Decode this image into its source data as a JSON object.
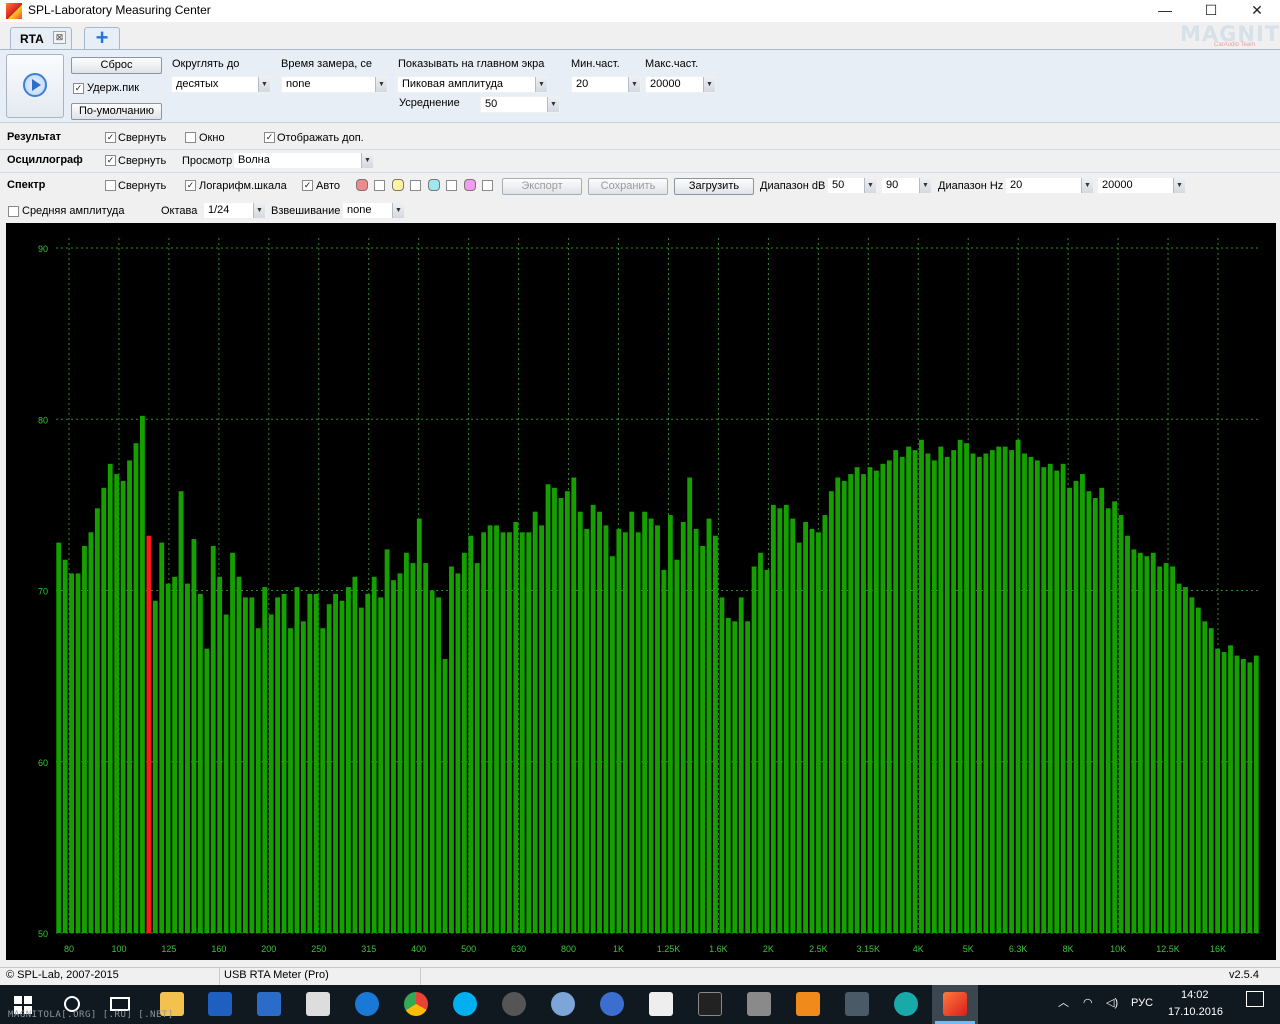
{
  "window": {
    "title": "SPL-Laboratory Measuring Center",
    "min": "—",
    "max": "☐",
    "close": "✕"
  },
  "tabs": {
    "rta_label": "RTA",
    "close_glyph": "⊠",
    "add_glyph": "+"
  },
  "logo": {
    "main": "MAGNITOLA",
    "sub": "CarAudio Team"
  },
  "toolbar": {
    "reset": "Сброс",
    "hold_peak": "Удерж.пик",
    "hold_peak_checked": true,
    "default": "По-умолчанию",
    "round_label": "Округлять до",
    "round_value": "десятых",
    "time_label": "Время замера, се",
    "time_value": "none",
    "show_label": "Показывать на главном экра",
    "show_value": "Пиковая амплитуда",
    "avg_label": "Усреднение",
    "avg_value": "50",
    "min_freq_label": "Мин.част.",
    "min_freq_value": "20",
    "max_freq_label": "Макс.част.",
    "max_freq_value": "20000"
  },
  "result_row": {
    "label": "Результат",
    "collapse": "Свернуть",
    "window": "Окно",
    "show_extra": "Отображать доп."
  },
  "osc_row": {
    "label": "Осциллограф",
    "collapse": "Свернуть",
    "view_label": "Просмотр",
    "view_value": "Волна"
  },
  "spectrum_row": {
    "label": "Спектр",
    "collapse": "Свернуть",
    "log_scale": "Логарифм.шкала",
    "auto": "Авто",
    "colors": [
      "#f08a8a",
      "#fff3a0",
      "#9ee8f0",
      "#f49af0"
    ],
    "export": "Экспорт",
    "save": "Сохранить",
    "load": "Загрузить",
    "db_range_label": "Диапазон dB",
    "db_min": "50",
    "db_max": "90",
    "hz_range_label": "Диапазон Hz",
    "hz_min": "20",
    "hz_max": "20000"
  },
  "fourth_row": {
    "avg_amp": "Средняя амплитуда",
    "octave_label": "Октава",
    "octave_value": "1/24",
    "weighting_label": "Взвешивание",
    "weighting_value": "none"
  },
  "chart_data": {
    "type": "bar",
    "ylim": [
      50,
      90
    ],
    "y_ticks": [
      "90",
      "80",
      "70",
      "60",
      "50"
    ],
    "x_tick_labels": [
      "80",
      "100",
      "125",
      "160",
      "200",
      "250",
      "315",
      "400",
      "500",
      "630",
      "800",
      "1K",
      "1.25K",
      "1.6K",
      "2K",
      "2.5K",
      "3.15K",
      "4K",
      "5K",
      "6.3K",
      "8K",
      "10K",
      "12.5K",
      "16K"
    ],
    "grid": true,
    "peak_bar_index": 14,
    "peak_color": "#ff1a1a",
    "values": [
      72.8,
      71.8,
      71.0,
      71.0,
      72.6,
      73.4,
      74.8,
      76.0,
      77.4,
      76.8,
      76.4,
      77.6,
      78.6,
      80.2,
      73.2,
      69.4,
      72.8,
      70.4,
      70.8,
      75.8,
      70.4,
      73.0,
      69.8,
      66.6,
      72.6,
      70.8,
      68.6,
      72.2,
      70.8,
      69.6,
      69.6,
      67.8,
      70.2,
      68.6,
      69.6,
      69.8,
      67.8,
      70.2,
      68.2,
      69.8,
      69.8,
      67.8,
      69.2,
      69.8,
      69.4,
      70.2,
      70.8,
      69.0,
      69.8,
      70.8,
      69.6,
      72.4,
      70.6,
      71.0,
      72.2,
      71.6,
      74.2,
      71.6,
      70.0,
      69.6,
      66.0,
      71.4,
      71.0,
      72.2,
      73.2,
      71.6,
      73.4,
      73.8,
      73.8,
      73.4,
      73.4,
      74.0,
      73.4,
      73.4,
      74.6,
      73.8,
      76.2,
      76.0,
      75.4,
      75.8,
      76.6,
      74.6,
      73.6,
      75.0,
      74.6,
      73.8,
      72.0,
      73.6,
      73.4,
      74.6,
      73.4,
      74.6,
      74.2,
      73.8,
      71.2,
      74.4,
      71.8,
      74.0,
      76.6,
      73.6,
      72.6,
      74.2,
      73.2,
      69.6,
      68.4,
      68.2,
      69.6,
      68.2,
      71.4,
      72.2,
      71.2,
      75.0,
      74.8,
      75.0,
      74.2,
      72.8,
      74.0,
      73.6,
      73.4,
      74.4,
      75.8,
      76.6,
      76.4,
      76.8,
      77.2,
      76.8,
      77.2,
      77.0,
      77.4,
      77.6,
      78.2,
      77.8,
      78.4,
      78.2,
      78.8,
      78.0,
      77.6,
      78.4,
      77.8,
      78.2,
      78.8,
      78.6,
      78.0,
      77.8,
      78.0,
      78.2,
      78.4,
      78.4,
      78.2,
      78.8,
      78.0,
      77.8,
      77.6,
      77.2,
      77.4,
      77.0,
      77.4,
      76.0,
      76.4,
      76.8,
      75.8,
      75.4,
      76.0,
      74.8,
      75.2,
      74.4,
      73.2,
      72.4,
      72.2,
      72.0,
      72.2,
      71.4,
      71.6,
      71.4,
      70.4,
      70.2,
      69.6,
      69.0,
      68.2,
      67.8,
      66.6,
      66.4,
      66.8,
      66.2,
      66.0,
      65.8,
      66.2
    ]
  },
  "status": {
    "copyright": "© SPL-Lab, 2007-2015",
    "device": "USB RTA Meter (Pro)",
    "version": "v2.5.4"
  },
  "taskbar": {
    "lang": "РУС",
    "time": "14:02",
    "date": "17.10.2016",
    "watermark": "MAGNITOLA[.ORG] [.RU] [.NET]"
  }
}
